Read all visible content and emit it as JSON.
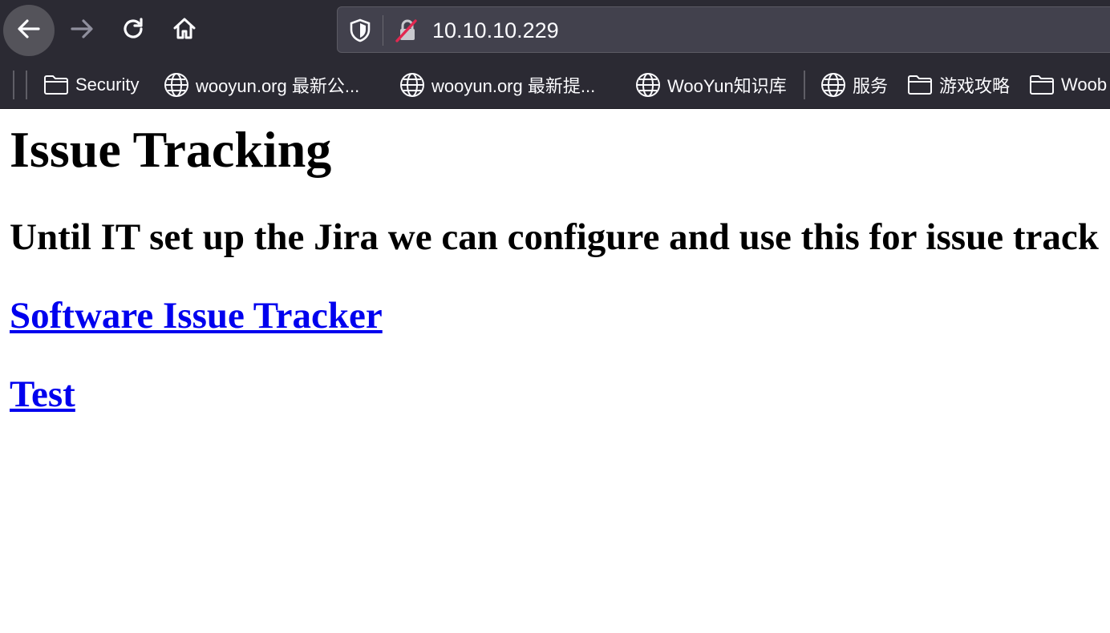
{
  "browser": {
    "url": "10.10.10.229",
    "nav": {
      "back": "back-arrow-icon",
      "forward": "forward-arrow-icon",
      "reload": "reload-icon",
      "home": "home-icon"
    },
    "bookmarks": [
      {
        "label": "Security",
        "icon": "folder-icon"
      },
      {
        "label": "wooyun.org 最新公...",
        "icon": "globe-icon"
      },
      {
        "label": "wooyun.org 最新提...",
        "icon": "globe-icon"
      },
      {
        "label": "WooYun知识库",
        "icon": "globe-icon"
      },
      {
        "label": "服务",
        "icon": "globe-icon"
      },
      {
        "label": "游戏攻略",
        "icon": "folder-icon"
      },
      {
        "label": "Woob",
        "icon": "folder-icon"
      }
    ],
    "colors": {
      "chrome": "#2b2a33",
      "urlbar": "#42414d",
      "insecure_slash": "#e22850"
    }
  },
  "page": {
    "title": "Issue Tracking",
    "subtitle": "Until IT set up the Jira we can configure and use this for issue track",
    "links": [
      {
        "label": "Software Issue Tracker"
      },
      {
        "label": "Test"
      }
    ],
    "colors": {
      "link": "#0000ee"
    }
  }
}
